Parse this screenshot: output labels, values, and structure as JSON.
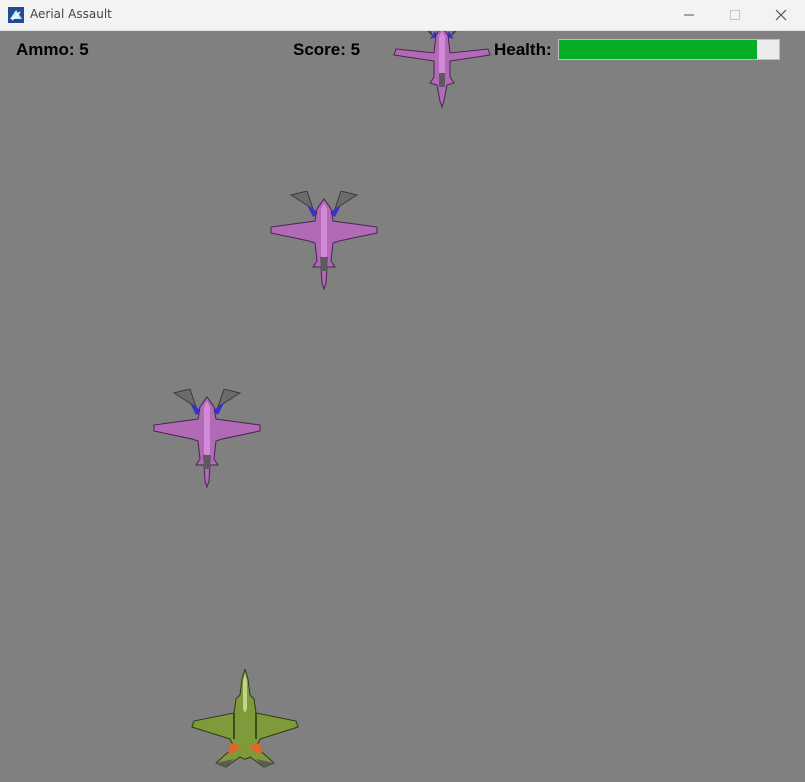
{
  "window": {
    "title": "Aerial Assault",
    "controls": [
      "minimize-icon",
      "maximize-icon",
      "close-icon"
    ]
  },
  "hud": {
    "ammo_label": "Ammo: 5",
    "score_label": "Score: 5",
    "health_label": "Health:",
    "ammo": 5,
    "score": 5,
    "health_fraction": 0.9
  },
  "colors": {
    "background": "#808080",
    "health_fill": "#06ae28",
    "health_empty": "#ececec",
    "enemy_body": "#b06ab6",
    "player_body": "#7f9a3a"
  },
  "sprites": {
    "enemy_count": 3,
    "player_count": 1
  }
}
